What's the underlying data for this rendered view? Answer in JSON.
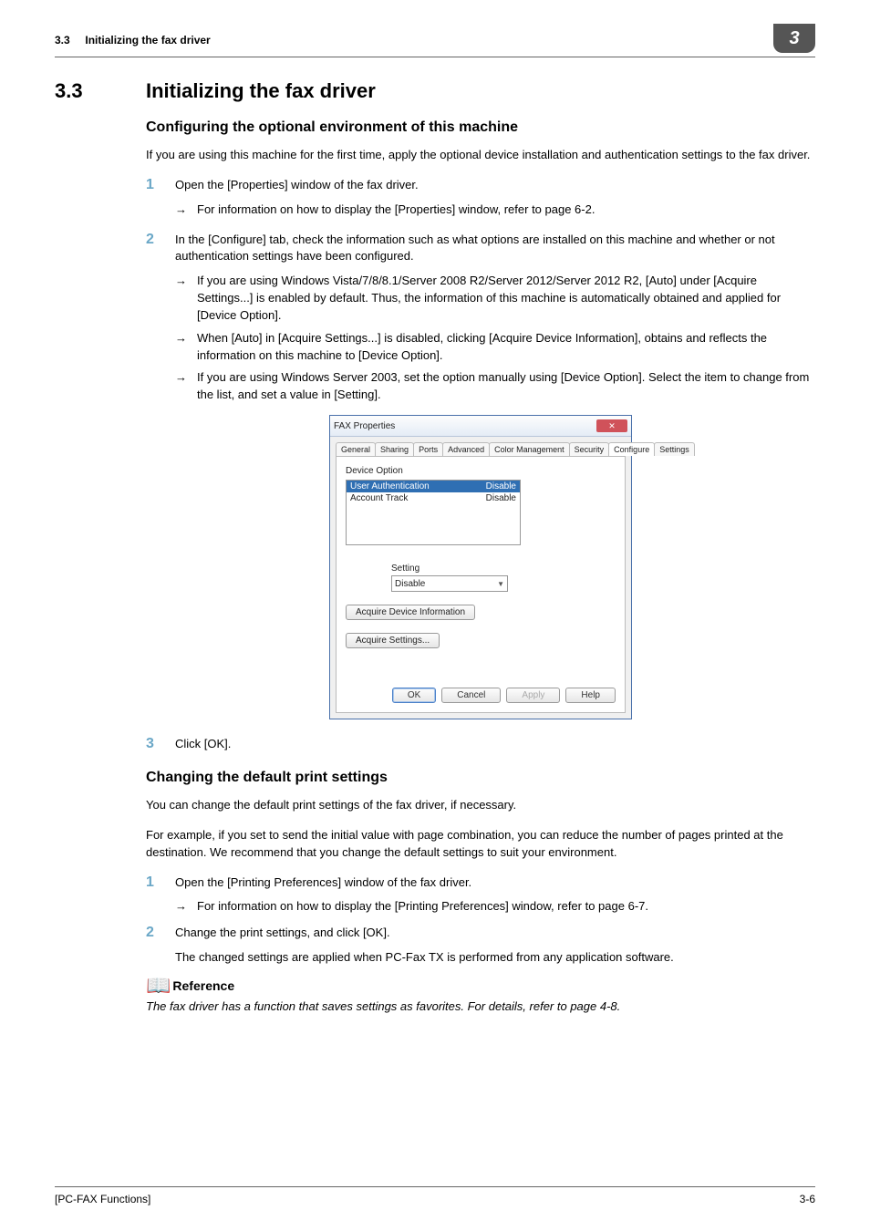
{
  "header": {
    "sec_no": "3.3",
    "running_title": "Initializing the fax driver",
    "chapter_badge": "3"
  },
  "s1": {
    "num": "3.3",
    "title": "Initializing the fax driver",
    "sub1": "Configuring the optional environment of this machine",
    "intro": "If you are using this machine for the first time, apply the optional device installation and authentication settings to the fax driver.",
    "steps": {
      "n1": "1",
      "t1": "Open the [Properties] window of the fax driver.",
      "t1a": "For information on how to display the [Properties] window, refer to page 6-2.",
      "n2": "2",
      "t2": "In the [Configure] tab, check the information such as what options are installed on this machine and whether or not authentication settings have been configured.",
      "t2a": "If you are using Windows Vista/7/8/8.1/Server 2008 R2/Server 2012/Server 2012 R2, [Auto] under [Acquire Settings...] is enabled by default. Thus, the information of this machine is automatically obtained and applied for [Device Option].",
      "t2b": "When [Auto] in [Acquire Settings...] is disabled, clicking [Acquire Device Information], obtains and reflects the information on this machine to [Device Option].",
      "t2c": "If you are using Windows Server 2003, set the option manually using [Device Option]. Select the item to change from the list, and set a value in [Setting].",
      "n3": "3",
      "t3": "Click [OK]."
    }
  },
  "dialog": {
    "title": "FAX Properties",
    "close": "✕",
    "tabs": {
      "t0": "General",
      "t1": "Sharing",
      "t2": "Ports",
      "t3": "Advanced",
      "t4": "Color Management",
      "t5": "Security",
      "t6": "Configure",
      "t7": "Settings"
    },
    "group_label": "Device Option",
    "row1_l": "User Authentication",
    "row1_r": "Disable",
    "row2_l": "Account Track",
    "row2_r": "Disable",
    "setting_label": "Setting",
    "setting_value": "Disable",
    "btn_acquire_dev": "Acquire Device Information",
    "btn_acquire_set": "Acquire Settings...",
    "btn_ok": "OK",
    "btn_cancel": "Cancel",
    "btn_apply": "Apply",
    "btn_help": "Help"
  },
  "s2": {
    "sub": "Changing the default print settings",
    "p1": "You can change the default print settings of the fax driver, if necessary.",
    "p2": "For example, if you set to send the initial value with page combination, you can reduce the number of pages printed at the destination. We recommend that you change the default settings to suit your environment.",
    "n1": "1",
    "t1": "Open the [Printing Preferences] window of the fax driver.",
    "t1a": "For information on how to display the [Printing Preferences] window, refer to page 6-7.",
    "n2": "2",
    "t2": "Change the print settings, and click [OK].",
    "t2_res": "The changed settings are applied when PC-Fax TX is performed from any application software.",
    "ref_label": "Reference",
    "ref_body": "The fax driver has a function that saves settings as favorites. For details, refer to page 4-8."
  },
  "footer": {
    "left": "[PC-FAX Functions]",
    "right": "3-6"
  }
}
